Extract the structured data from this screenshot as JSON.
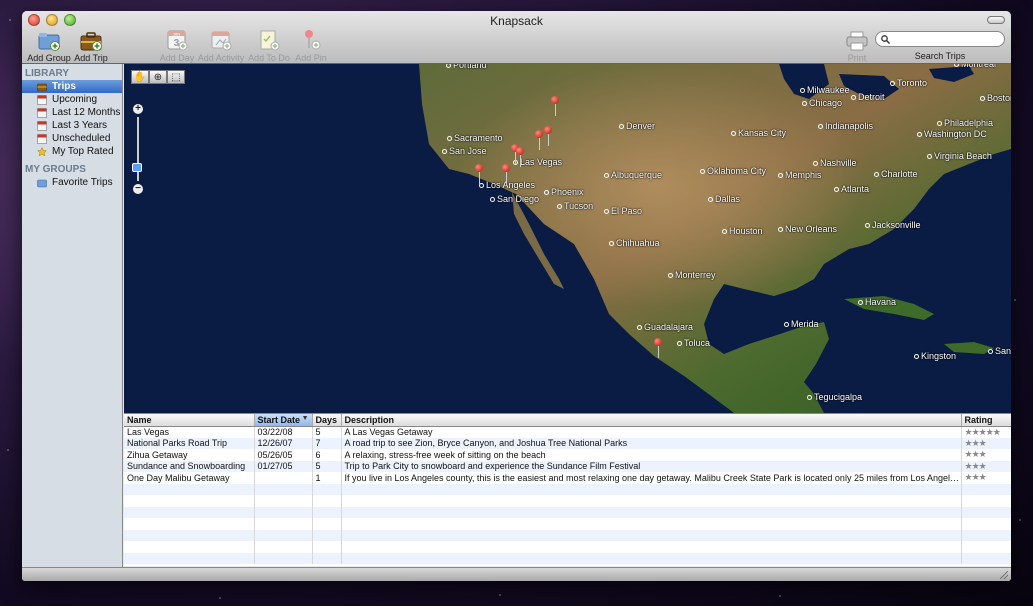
{
  "window": {
    "title": "Knapsack"
  },
  "toolbar": {
    "add_group": "Add Group",
    "add_trip": "Add Trip",
    "add_day": "Add Day",
    "add_activity": "Add Activity",
    "add_todo": "Add To Do",
    "add_pin": "Add Pin",
    "print": "Print",
    "search_label": "Search Trips",
    "search_value": "",
    "calendar_icon_month": "JAN",
    "calendar_icon_day": "3"
  },
  "sidebar": {
    "library_header": "LIBRARY",
    "library_items": [
      {
        "label": "Trips",
        "icon": "trips-icon",
        "selected": true
      },
      {
        "label": "Upcoming",
        "icon": "calendar-icon"
      },
      {
        "label": "Last 12 Months",
        "icon": "calendar-icon"
      },
      {
        "label": "Last 3 Years",
        "icon": "calendar-icon"
      },
      {
        "label": "Unscheduled",
        "icon": "calendar-icon"
      },
      {
        "label": "My Top Rated",
        "icon": "star-icon"
      }
    ],
    "groups_header": "MY GROUPS",
    "group_items": [
      {
        "label": "Favorite Trips",
        "icon": "folder-icon"
      }
    ]
  },
  "map": {
    "cities": [
      "Portland",
      "Sacramento",
      "San Jose",
      "Los Angeles",
      "San Diego",
      "Las Vegas",
      "Phoenix",
      "Tucson",
      "El Paso",
      "Albuquerque",
      "Chihuahua",
      "Denver",
      "Kansas City",
      "Oklahoma City",
      "Dallas",
      "Houston",
      "Memphis",
      "Nashville",
      "Atlanta",
      "Charlotte",
      "Jacksonville",
      "New Orleans",
      "Monterrey",
      "Guadalajara",
      "Toluca",
      "Merida",
      "Havana",
      "Kingston",
      "Tegucigalpa",
      "Milwaukee",
      "Chicago",
      "Detroit",
      "Toronto",
      "Montreal",
      "Boston",
      "Indianapolis",
      "Philadelphia",
      "Washington DC",
      "Virginia Beach",
      "San"
    ]
  },
  "table": {
    "columns": [
      "Name",
      "Start Date",
      "Days",
      "Description",
      "Rating"
    ],
    "sorted_column": "Start Date",
    "sort_indicator": "▼",
    "rows": [
      [
        "Las Vegas",
        "03/22/08",
        "5",
        "A Las Vegas Getaway",
        "★★★★★"
      ],
      [
        "National Parks Road Trip",
        "12/26/07",
        "7",
        "A road trip to see Zion, Bryce Canyon, and Joshua Tree National Parks",
        "★★★"
      ],
      [
        "Zihua Getaway",
        "05/26/05",
        "6",
        "A relaxing, stress-free week of sitting on the beach",
        "★★★"
      ],
      [
        "Sundance and Snowboarding",
        "01/27/05",
        "5",
        "Trip to Park City to snowboard and experience the Sundance Film Festival",
        "★★★"
      ],
      [
        "One Day Malibu Getaway",
        "",
        "1",
        "If you live in Los Angeles county, this is the easiest and most relaxing one day getaway. Malibu Creek State Park is located only 25 miles from Los Angeles, but feels l...",
        "★★★"
      ]
    ]
  },
  "colors": {
    "selection": "#2e6bc9",
    "pin": "#b3100a",
    "ocean": "#0a1b3d"
  }
}
